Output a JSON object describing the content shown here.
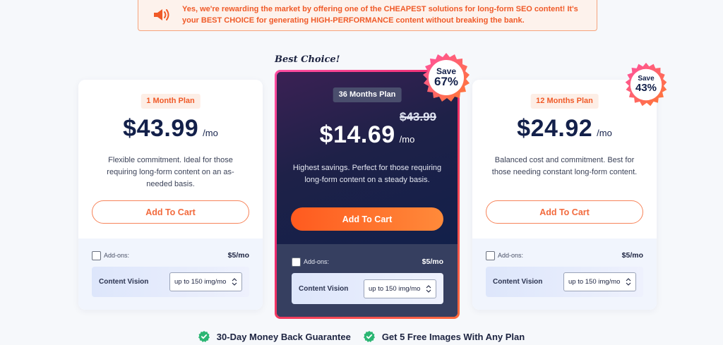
{
  "banner": {
    "icon": "megaphone-icon",
    "line1": "Yes, we're rewarding the market by offering one of the CHEAPEST solutions for long-form SEO content! It's",
    "line2": "your BEST CHOICE for generating HIGH-PERFORMANCE content without breaking the bank."
  },
  "plans": [
    {
      "badge": "1 Month Plan",
      "price": "$43.99",
      "per": "/mo",
      "description": "Flexible commitment. Ideal for those requiring long-form content on an as-needed basis.",
      "cart_label": "Add To Cart",
      "addons_label": "Add-ons:",
      "addons_price": "$5/mo",
      "vision_label": "Content Vision",
      "vision_value": "up to 150 img/mo"
    },
    {
      "ribbon": "Best Choice!",
      "badge": "36 Months Plan",
      "old_price": "$43.99",
      "price": "$14.69",
      "per": "/mo",
      "description": "Highest savings. Perfect for those requiring long-form content on a steady basis.",
      "cart_label": "Add To Cart",
      "addons_label": "Add-ons:",
      "addons_price": "$5/mo",
      "vision_label": "Content Vision",
      "vision_value": "up to 150 img/mo",
      "save_label": "Save",
      "save_pct": "67%"
    },
    {
      "badge": "12 Months Plan",
      "price": "$24.92",
      "per": "/mo",
      "description": "Balanced cost and commitment. Best for those needing constant long-form content.",
      "cart_label": "Add To Cart",
      "addons_label": "Add-ons:",
      "addons_price": "$5/mo",
      "vision_label": "Content Vision",
      "vision_value": "up to 150 img/mo",
      "save_label": "Save",
      "save_pct": "43%"
    }
  ],
  "guarantees": [
    {
      "icon": "check-badge-icon",
      "label": "30-Day Money Back Guarantee"
    },
    {
      "icon": "check-badge-icon",
      "label": "Get 5 Free Images With Any Plan"
    }
  ],
  "colors": {
    "accent_orange": "#f05a28",
    "featured_dark": "#12204a",
    "featured_border": "#ee2a6b",
    "success_green": "#2bb673"
  }
}
